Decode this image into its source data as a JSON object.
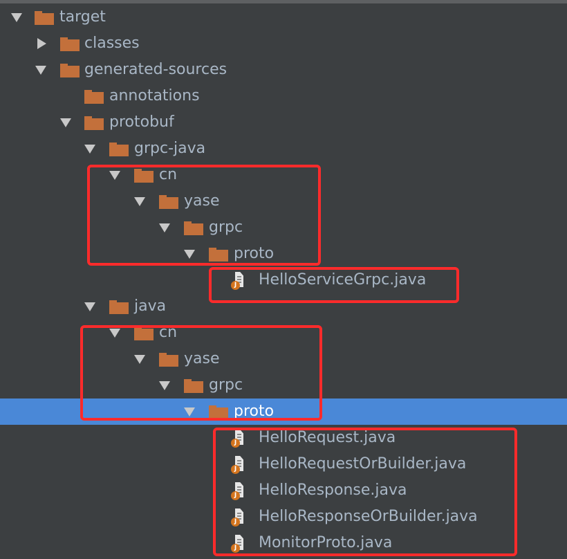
{
  "tree": {
    "target": "target",
    "classes": "classes",
    "generated_sources": "generated-sources",
    "annotations": "annotations",
    "protobuf": "protobuf",
    "grpc_java": "grpc-java",
    "g_cn": "cn",
    "g_yase": "yase",
    "g_grpc": "grpc",
    "g_proto": "proto",
    "g_file": "HelloServiceGrpc.java",
    "java": "java",
    "j_cn": "cn",
    "j_yase": "yase",
    "j_grpc": "grpc",
    "j_proto": "proto",
    "files": [
      "HelloRequest.java",
      "HelloRequestOrBuilder.java",
      "HelloResponse.java",
      "HelloResponseOrBuilder.java",
      "MonitorProto.java"
    ],
    "java_badge": "J"
  },
  "colors": {
    "background": "#3c3f41",
    "selection": "#4a88d7",
    "folder": "#c3703b",
    "text": "#a9b7c6",
    "highlight": "#ff2b2b"
  },
  "icons": {
    "expanded": "triangle-down-icon",
    "collapsed": "triangle-right-icon",
    "folder": "folder-icon",
    "java_file": "java-file-icon"
  }
}
